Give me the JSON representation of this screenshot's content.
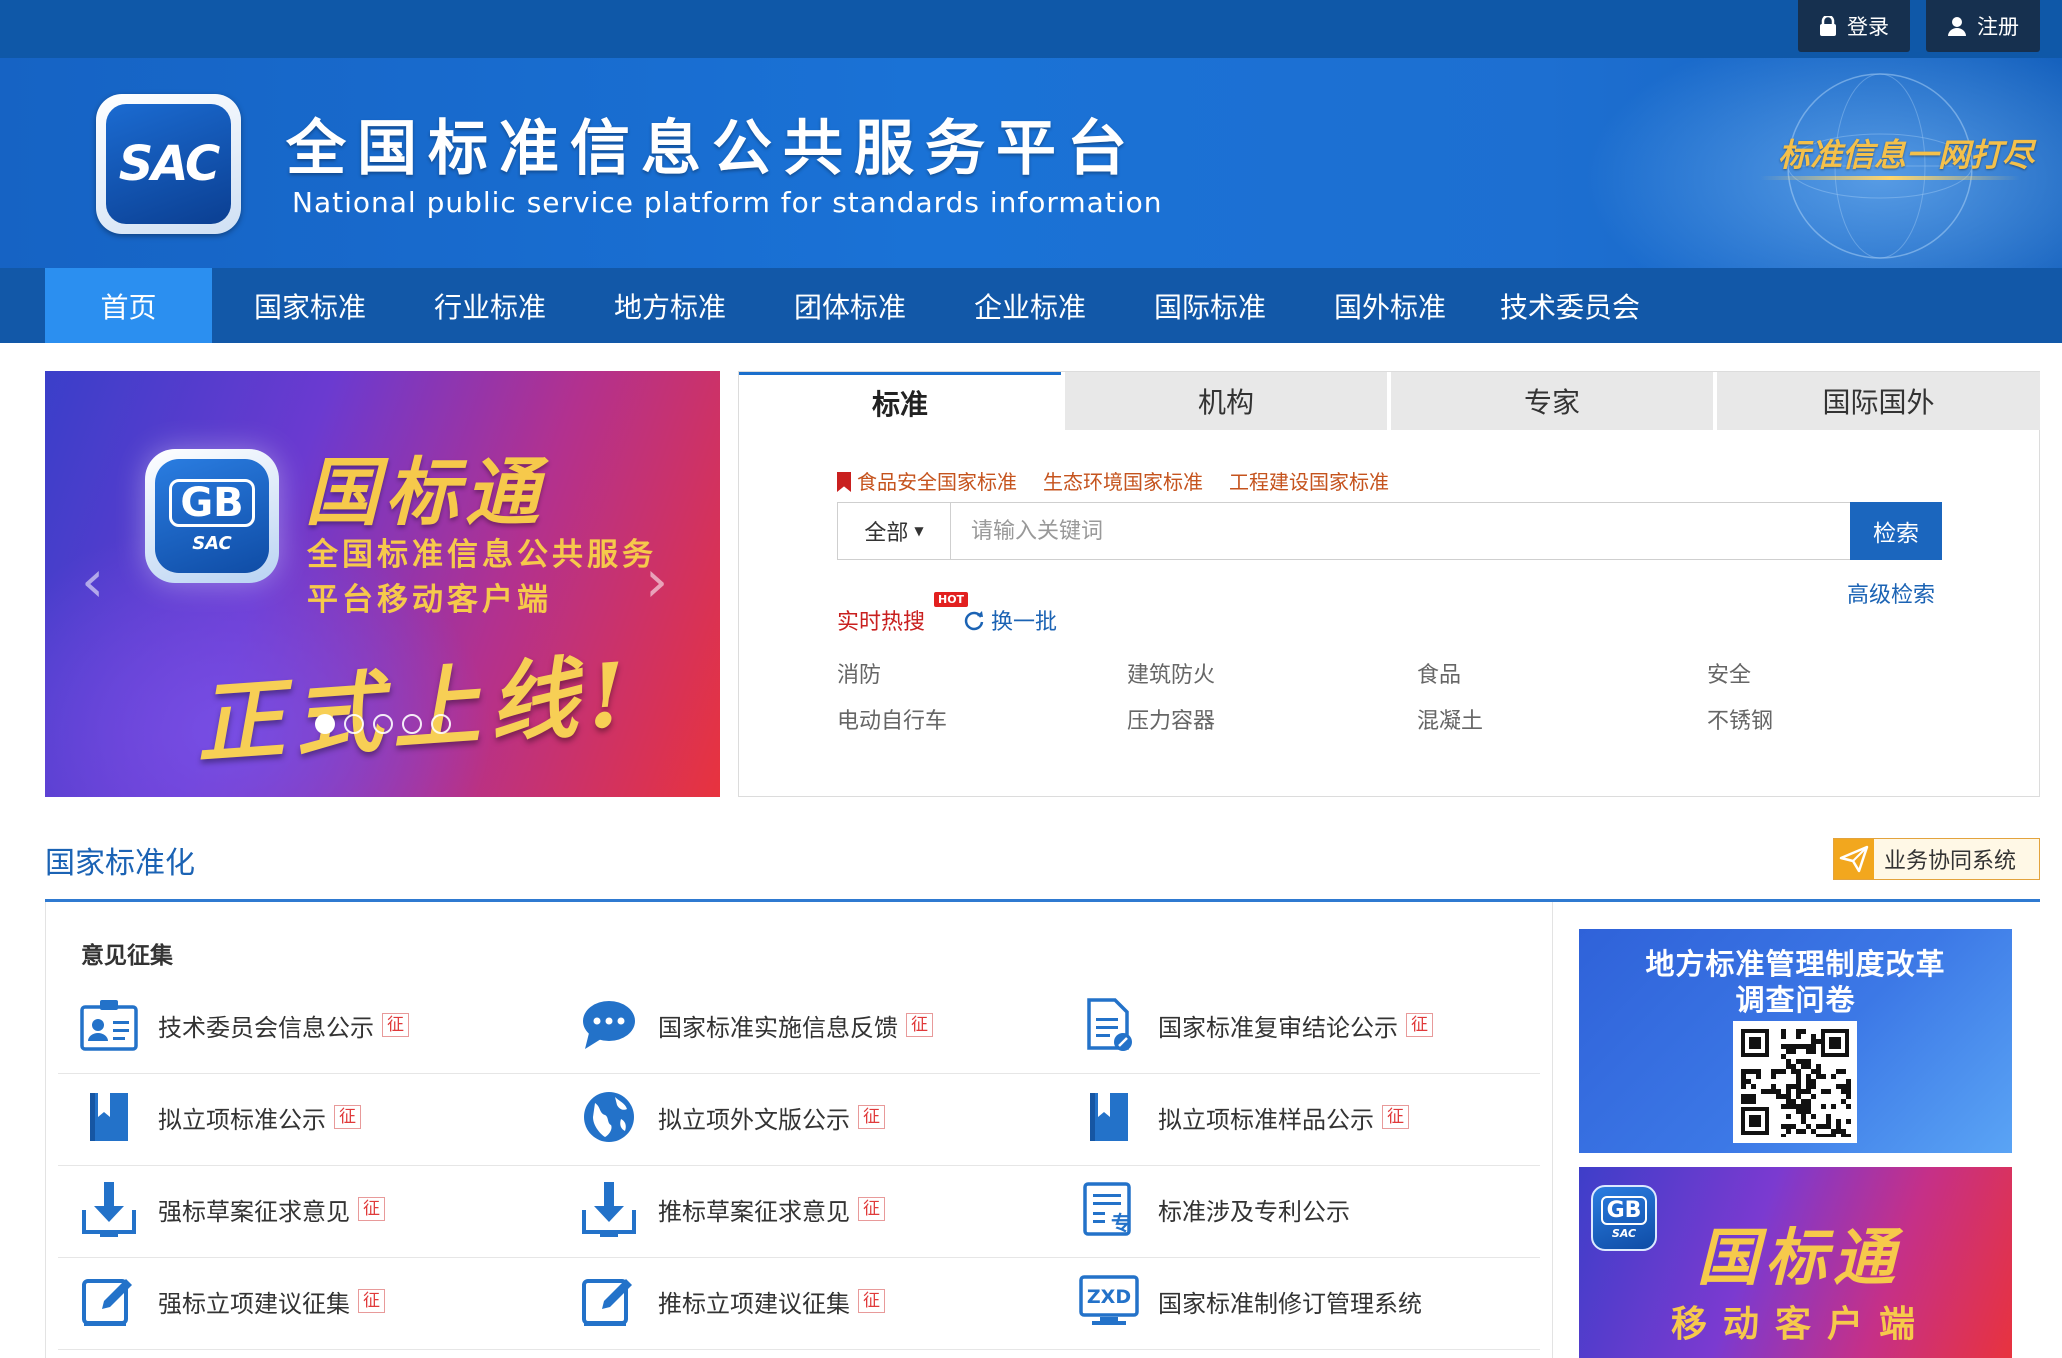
{
  "topbar": {
    "login_label": "登录",
    "register_label": "注册"
  },
  "header": {
    "logo_text": "SAC",
    "title": "全国标准信息公共服务平台",
    "subtitle": "National public service platform  for standards information",
    "slogan": "标准信息一网打尽"
  },
  "nav": {
    "items": [
      "首页",
      "国家标准",
      "行业标准",
      "地方标准",
      "团体标准",
      "企业标准",
      "国际标准",
      "国外标准",
      "技术委员会"
    ],
    "active_index": 0
  },
  "carousel": {
    "app_icon_gb": "GB",
    "app_icon_sac": "SAC",
    "title": "国标通",
    "line1": "全国标准信息公共服务",
    "line2": "平台移动客户端",
    "tagline": "正式上线!",
    "slide_count": 5,
    "current_slide": 1
  },
  "search": {
    "tabs": [
      "标准",
      "机构",
      "专家",
      "国际国外"
    ],
    "active_tab": 0,
    "quick_links": [
      "食品安全国家标准",
      "生态环境国家标准",
      "工程建设国家标准"
    ],
    "scope": "全部",
    "placeholder": "请输入关键词",
    "button": "检索",
    "advanced": "高级检索",
    "hot_label": "实时热搜",
    "hot_badge": "HOT",
    "refresh_label": "换一批",
    "hot_terms": [
      "消防",
      "建筑防火",
      "食品",
      "安全",
      "电动自行车",
      "压力容器",
      "混凝土",
      "不锈钢"
    ]
  },
  "section": {
    "title": "国家标准化",
    "biz_button": "业务协同系统",
    "opinion_title": "意见征集",
    "zheng": "征",
    "items": [
      {
        "label": "技术委员会信息公示",
        "icon": "id-card-icon",
        "zheng": true
      },
      {
        "label": "国家标准实施信息反馈",
        "icon": "chat-bubble-icon",
        "zheng": true
      },
      {
        "label": "国家标准复审结论公示",
        "icon": "document-edit-icon",
        "zheng": true
      },
      {
        "label": "拟立项标准公示",
        "icon": "bookmark-icon",
        "zheng": true
      },
      {
        "label": "拟立项外文版公示",
        "icon": "globe-icon",
        "zheng": true
      },
      {
        "label": "拟立项标准样品公示",
        "icon": "bookmark-icon",
        "zheng": true
      },
      {
        "label": "强标草案征求意见",
        "icon": "download-icon",
        "zheng": true
      },
      {
        "label": "推标草案征求意见",
        "icon": "download-icon",
        "zheng": true
      },
      {
        "label": "标准涉及专利公示",
        "icon": "patent-document-icon",
        "zheng": false
      },
      {
        "label": "强标立项建议征集",
        "icon": "edit-icon",
        "zheng": true
      },
      {
        "label": "推标立项建议征集",
        "icon": "edit-icon",
        "zheng": true
      },
      {
        "label": "国家标准制修订管理系统",
        "icon": "zxd-monitor-icon",
        "zheng": false
      }
    ],
    "patent_glyph": "专",
    "zxd_text": "ZXD"
  },
  "ads": {
    "survey_title1": "地方标准管理制度改革",
    "survey_title2": "调查问卷",
    "app_title": "国标通",
    "app_sub": "移动客户端",
    "app_icon_gb": "GB",
    "app_icon_sac": "SAC"
  },
  "colors": {
    "nav_bg": "#1258a8",
    "nav_active": "#2b8ff0",
    "accent_blue": "#1b63b4",
    "hot_red": "#c9201f",
    "link_orange": "#c5531d"
  }
}
